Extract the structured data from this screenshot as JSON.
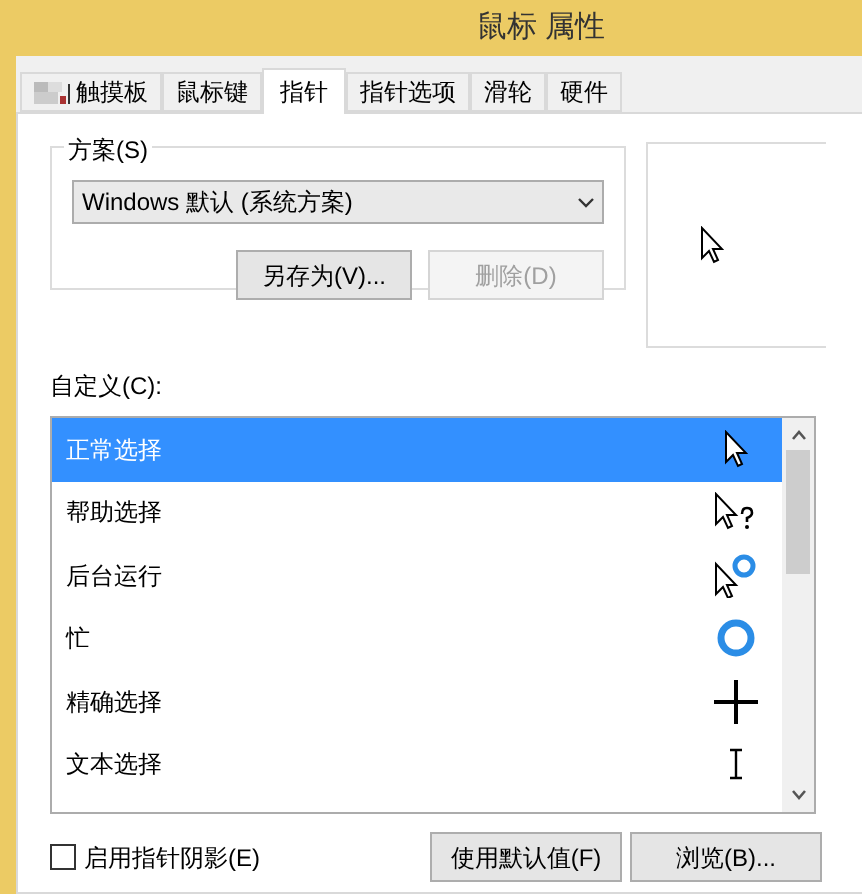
{
  "window": {
    "title": "鼠标 属性"
  },
  "tabs": [
    {
      "label": "触摸板",
      "selected": false,
      "kind": "icon"
    },
    {
      "label": "鼠标键",
      "selected": false,
      "kind": "plain"
    },
    {
      "label": "指针",
      "selected": true,
      "kind": "plain"
    },
    {
      "label": "指针选项",
      "selected": false,
      "kind": "plain"
    },
    {
      "label": "滑轮",
      "selected": false,
      "kind": "plain"
    },
    {
      "label": "硬件",
      "selected": false,
      "kind": "plain"
    }
  ],
  "scheme": {
    "label": "方案(S)",
    "value": "Windows 默认 (系统方案)",
    "buttons": [
      {
        "label": "另存为(V)...",
        "disabled": false
      },
      {
        "label": "删除(D)",
        "disabled": true
      }
    ]
  },
  "customize": {
    "label": "自定义(C):",
    "items": [
      {
        "label": "正常选择",
        "kind": "arrow",
        "selected": true
      },
      {
        "label": "帮助选择",
        "kind": "help",
        "selected": false
      },
      {
        "label": "后台运行",
        "kind": "working",
        "selected": false
      },
      {
        "label": "忙",
        "kind": "busy",
        "selected": false
      },
      {
        "label": "精确选择",
        "kind": "cross",
        "selected": false
      },
      {
        "label": "文本选择",
        "kind": "text",
        "selected": false
      }
    ]
  },
  "shadow": {
    "label": "启用指针阴影(E)",
    "checked": false
  },
  "buttons": [
    {
      "label": "使用默认值(F)"
    },
    {
      "label": "浏览(B)..."
    }
  ]
}
